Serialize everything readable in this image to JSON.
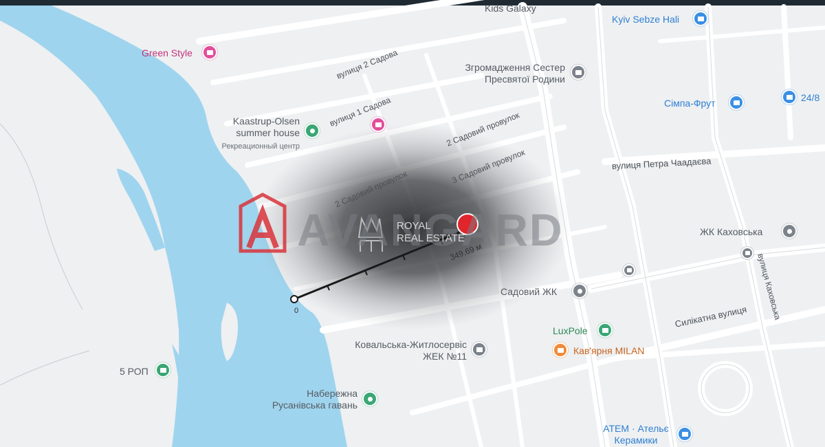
{
  "map": {
    "places": {
      "kids_galaxy": "Kids Galaxy",
      "kyiv_sebze_hali": "Kyiv Sebze Hali",
      "green_style": "Green Style",
      "church": [
        "Згромадження Сестер",
        "Пресвятої Родини"
      ],
      "simpa_frut": "Сімпа-Фрут",
      "open_24": "24/8",
      "kaastrup": [
        "Kaastrup-Olsen",
        "summer house"
      ],
      "kaastrup_sub": "Рекреационный центр",
      "zhk_kakhovska": "ЖК Каховська",
      "sadovyi_zhk": "Садовий ЖК",
      "luxpole": "LuxPole",
      "kavyarnya_milan": "Кав'ярня MILAN",
      "kovalska": [
        "Ковальська-Житлосервіс",
        "ЖЕК №11"
      ],
      "five_rop": "5 РОП",
      "naberezhna": [
        "Набережна",
        "Русанівська гавань"
      ],
      "atem": [
        "АТЕМ · Ательє",
        "Керамики"
      ]
    },
    "streets": {
      "sadova_2": "вулиця 2 Садова",
      "sadova_1": "вулиця 1 Садова",
      "sadovyi_2_a": "2 Садовий провулок",
      "sadovyi_2_b": "2 Садовий провулок",
      "sadovyi_3": "3 Садовий провулок",
      "chaadaieva": "вулиця Петра Чаадаєва",
      "kakhovska": "вулиця Каховська",
      "sylikatna": "Силікатна вулиця"
    },
    "measure": {
      "distance": "349,69 м",
      "start": "0"
    },
    "watermark": {
      "brand": "AVANGARD",
      "sub": [
        "ROYAL",
        "REAL ESTATE"
      ]
    },
    "colors": {
      "water": "#9fd4ee",
      "land": "#eef0f2",
      "road": "#ffffff",
      "pin_red": "#e0252c",
      "brand_red": "#d9343b"
    },
    "icons": {
      "poi_generic": "map-pin-icon",
      "poi_shop": "shopping-bag-icon",
      "poi_cart": "shopping-cart-icon",
      "poi_museum": "building-icon",
      "poi_park": "tree-icon",
      "poi_cafe": "coffee-icon",
      "poi_transit": "transit-icon",
      "target": "location-marker-icon"
    }
  }
}
